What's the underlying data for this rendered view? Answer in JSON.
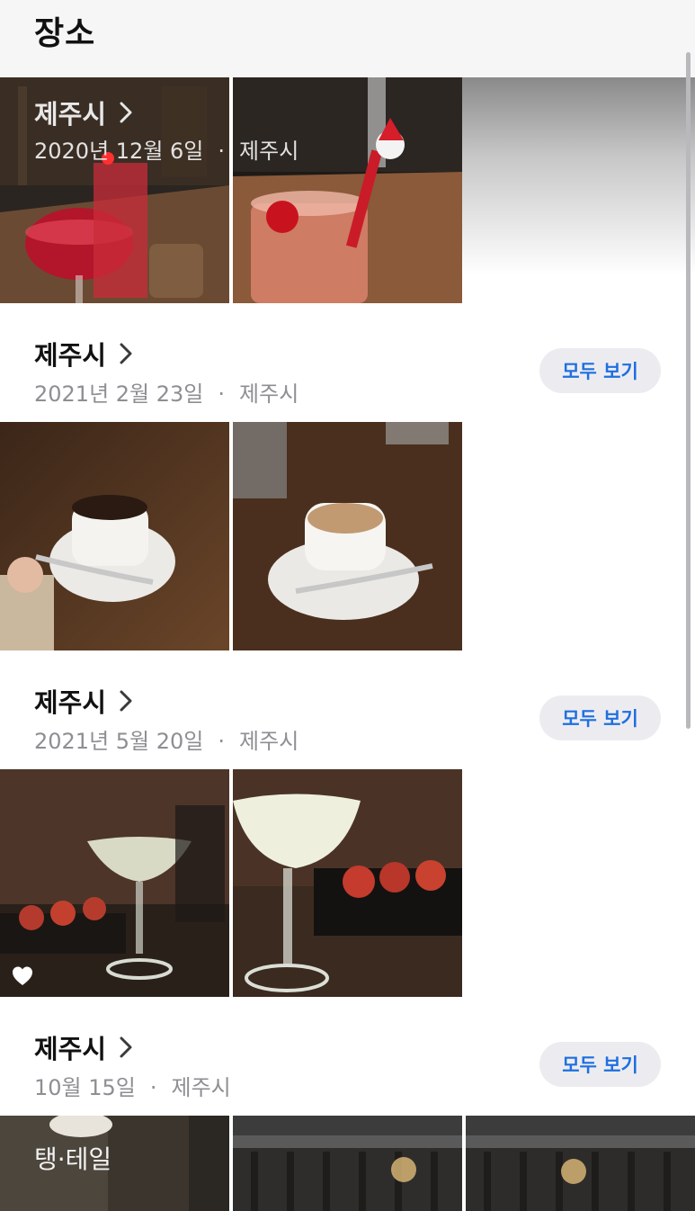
{
  "header": {
    "title": "장소"
  },
  "sections": [
    {
      "place": "제주시",
      "date": "2020년 12월 6일",
      "location": "제주시"
    },
    {
      "place": "제주시",
      "date": "2021년 2월 23일",
      "location": "제주시",
      "see_all_label": "모두 보기"
    },
    {
      "place": "제주시",
      "date": "2021년 5월 20일",
      "location": "제주시",
      "see_all_label": "모두 보기"
    },
    {
      "place": "제주시",
      "date": "10월 15일",
      "location": "제주시",
      "see_all_label": "모두 보기"
    }
  ],
  "separator": "·",
  "photo_text": {
    "sign": "탱·테일"
  },
  "colors": {
    "accent": "#1f6fe0",
    "secondary_text": "#8e8e93",
    "pill_bg": "#ececf0"
  }
}
